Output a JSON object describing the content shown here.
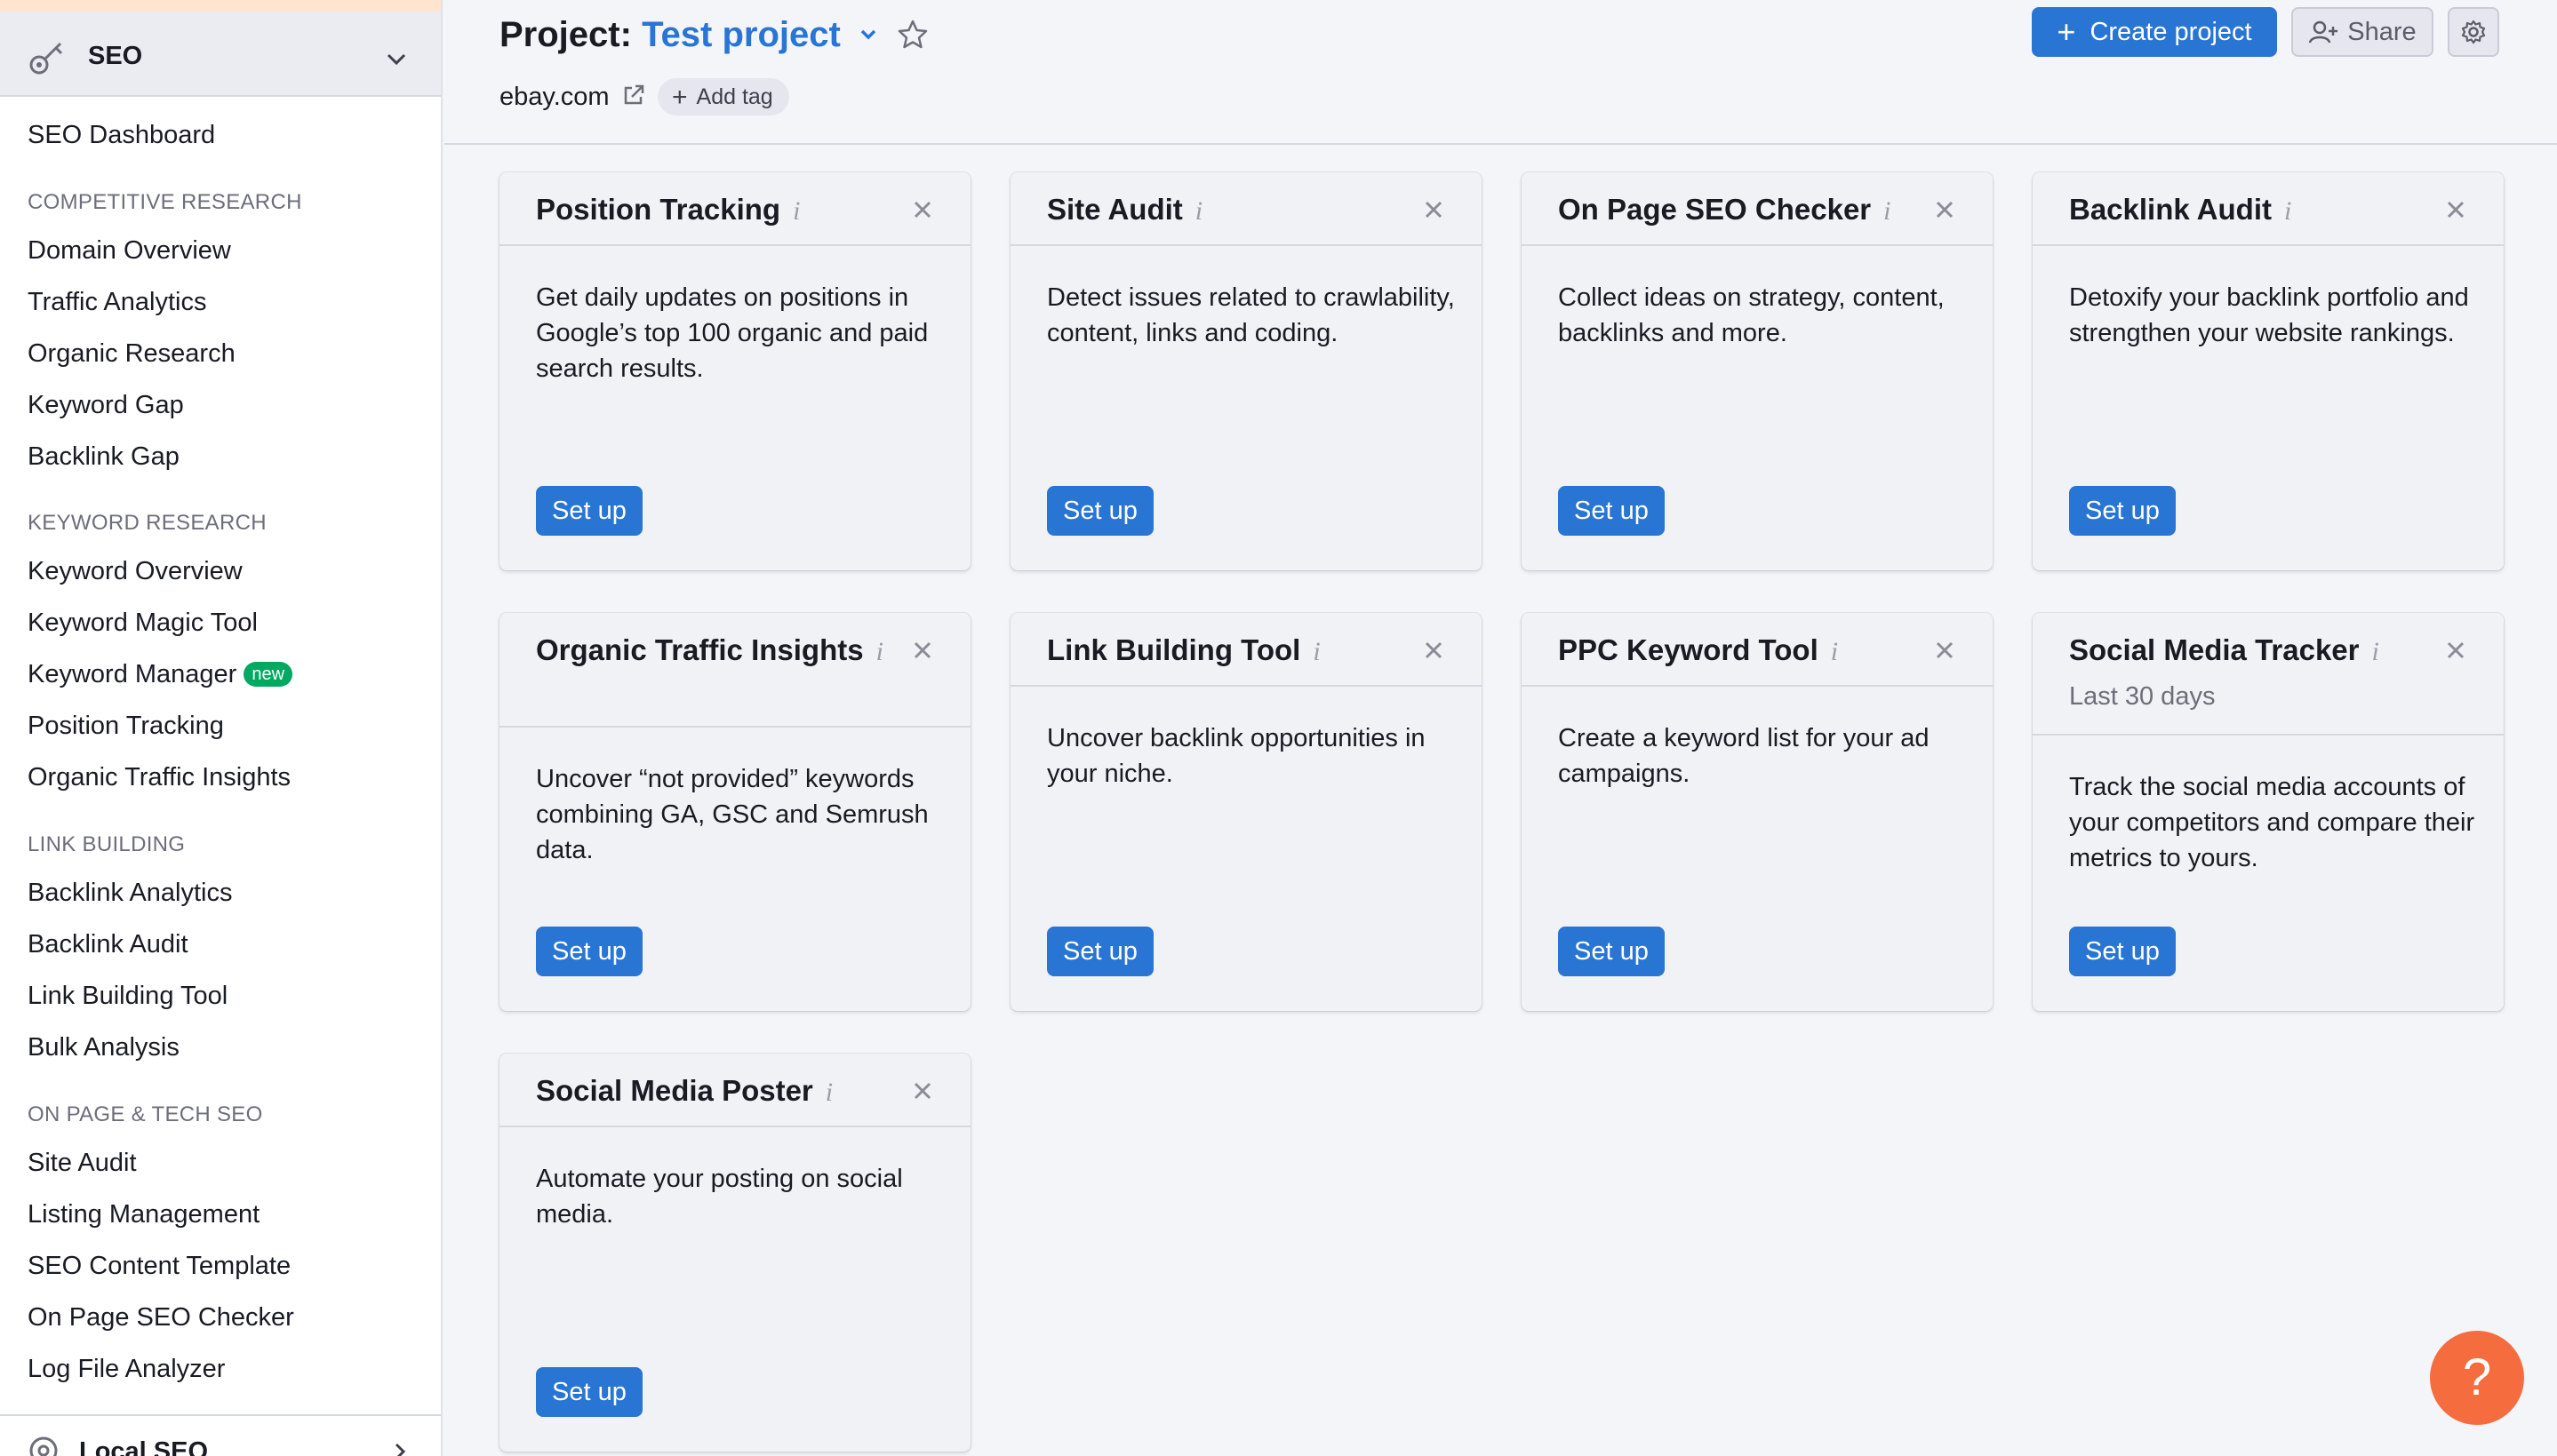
{
  "sidebar": {
    "main_label": "SEO",
    "dashboard": "SEO Dashboard",
    "sections": [
      {
        "title": "COMPETITIVE RESEARCH",
        "items": [
          "Domain Overview",
          "Traffic Analytics",
          "Organic Research",
          "Keyword Gap",
          "Backlink Gap"
        ]
      },
      {
        "title": "KEYWORD RESEARCH",
        "items": [
          "Keyword Overview",
          "Keyword Magic Tool",
          "Keyword Manager",
          "Position Tracking",
          "Organic Traffic Insights"
        ]
      },
      {
        "title": "LINK BUILDING",
        "items": [
          "Backlink Analytics",
          "Backlink Audit",
          "Link Building Tool",
          "Bulk Analysis"
        ]
      },
      {
        "title": "ON PAGE & TECH SEO",
        "items": [
          "Site Audit",
          "Listing Management",
          "SEO Content Template",
          "On Page SEO Checker",
          "Log File Analyzer"
        ]
      }
    ],
    "new_badge": "new",
    "next_group": "Local SEO"
  },
  "header": {
    "project_prefix": "Project:",
    "project_name": "Test project",
    "domain": "ebay.com",
    "add_tag": "Add tag",
    "create_project": "Create project",
    "share": "Share"
  },
  "cards": [
    {
      "title": "Position Tracking",
      "subtitle": "",
      "description": "Get daily updates on positions in Google’s top 100 organic and paid search results.",
      "button": "Set up"
    },
    {
      "title": "Site Audit",
      "subtitle": "",
      "description": "Detect issues related to crawlability, content, links and coding.",
      "button": "Set up"
    },
    {
      "title": "On Page SEO Checker",
      "subtitle": "",
      "description": "Collect ideas on strategy, content, backlinks and more.",
      "button": "Set up"
    },
    {
      "title": "Backlink Audit",
      "subtitle": "",
      "description": "Detoxify your backlink portfolio and strengthen your website rankings.",
      "button": "Set up"
    },
    {
      "title": "Organic Traffic Insights",
      "subtitle": "",
      "description": "Uncover “not provided” keywords combining GA, GSC and Semrush data.",
      "button": "Set up"
    },
    {
      "title": "Link Building Tool",
      "subtitle": "",
      "description": "Uncover backlink opportunities in your niche.",
      "button": "Set up"
    },
    {
      "title": "PPC Keyword Tool",
      "subtitle": "",
      "description": "Create a keyword list for your ad campaigns.",
      "button": "Set up"
    },
    {
      "title": "Social Media Tracker",
      "subtitle": "Last 30 days",
      "description": "Track the social media accounts of your competitors and compare their metrics to yours.",
      "button": "Set up"
    },
    {
      "title": "Social Media Poster",
      "subtitle": "",
      "description": "Automate your posting on social media.",
      "button": "Set up"
    }
  ],
  "help": "?",
  "colors": {
    "accent": "#2875d4",
    "help": "#f56d3f",
    "badge": "#00a961"
  },
  "icons": [
    "seo-key-icon",
    "chevron-down-icon",
    "star-icon",
    "external-link-icon",
    "plus-icon",
    "add-user-icon",
    "gear-icon",
    "info-icon",
    "close-icon",
    "location-icon",
    "chevron-right-icon"
  ]
}
